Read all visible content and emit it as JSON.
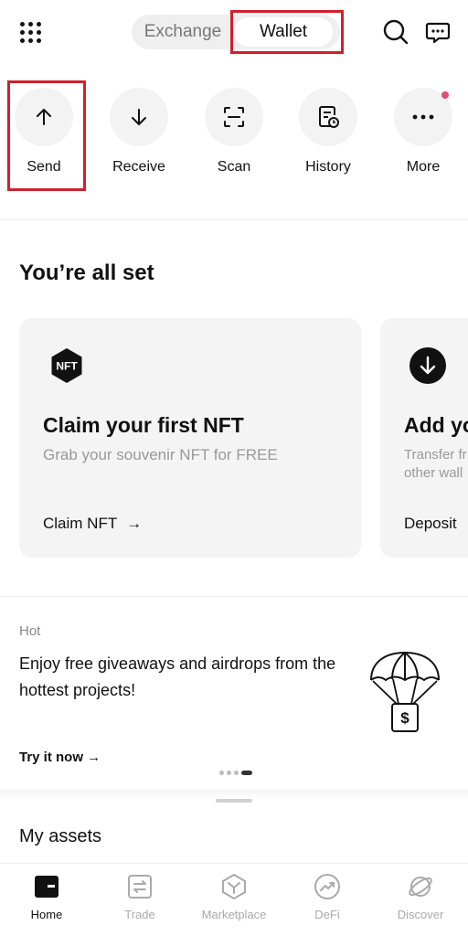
{
  "header": {
    "tabs": [
      {
        "label": "Exchange",
        "active": false
      },
      {
        "label": "Wallet",
        "active": true
      }
    ],
    "icons": [
      "apps-grid-icon",
      "search-icon",
      "chat-icon"
    ]
  },
  "quick_actions": [
    {
      "label": "Send",
      "icon": "arrow-up-icon"
    },
    {
      "label": "Receive",
      "icon": "arrow-down-icon"
    },
    {
      "label": "Scan",
      "icon": "scan-icon"
    },
    {
      "label": "History",
      "icon": "history-icon"
    },
    {
      "label": "More",
      "icon": "more-icon",
      "badge": true
    }
  ],
  "onboarding": {
    "title": "You’re all set",
    "cards": [
      {
        "icon_text": "NFT",
        "title": "Claim your first NFT",
        "subtitle": "Grab your souvenir NFT for FREE",
        "link": "Claim NFT"
      },
      {
        "title": "Add yo",
        "subtitle_line1": "Transfer fr",
        "subtitle_line2": "other wall",
        "link": "Deposit"
      }
    ]
  },
  "promo": {
    "tag": "Hot",
    "text": "Enjoy free giveaways and airdrops from the hottest projects!",
    "cta": "Try it now →",
    "icon": "parachute-icon",
    "pages": 4,
    "active_page": 3
  },
  "assets": {
    "title": "My assets"
  },
  "bottom_nav": [
    {
      "label": "Home",
      "active": true
    },
    {
      "label": "Trade",
      "active": false
    },
    {
      "label": "Marketplace",
      "active": false
    },
    {
      "label": "DeFi",
      "active": false
    },
    {
      "label": "Discover",
      "active": false
    }
  ],
  "colors": {
    "highlight": "#d21f2c",
    "badge": "#e04f6b",
    "card_bg": "#f4f4f4"
  }
}
